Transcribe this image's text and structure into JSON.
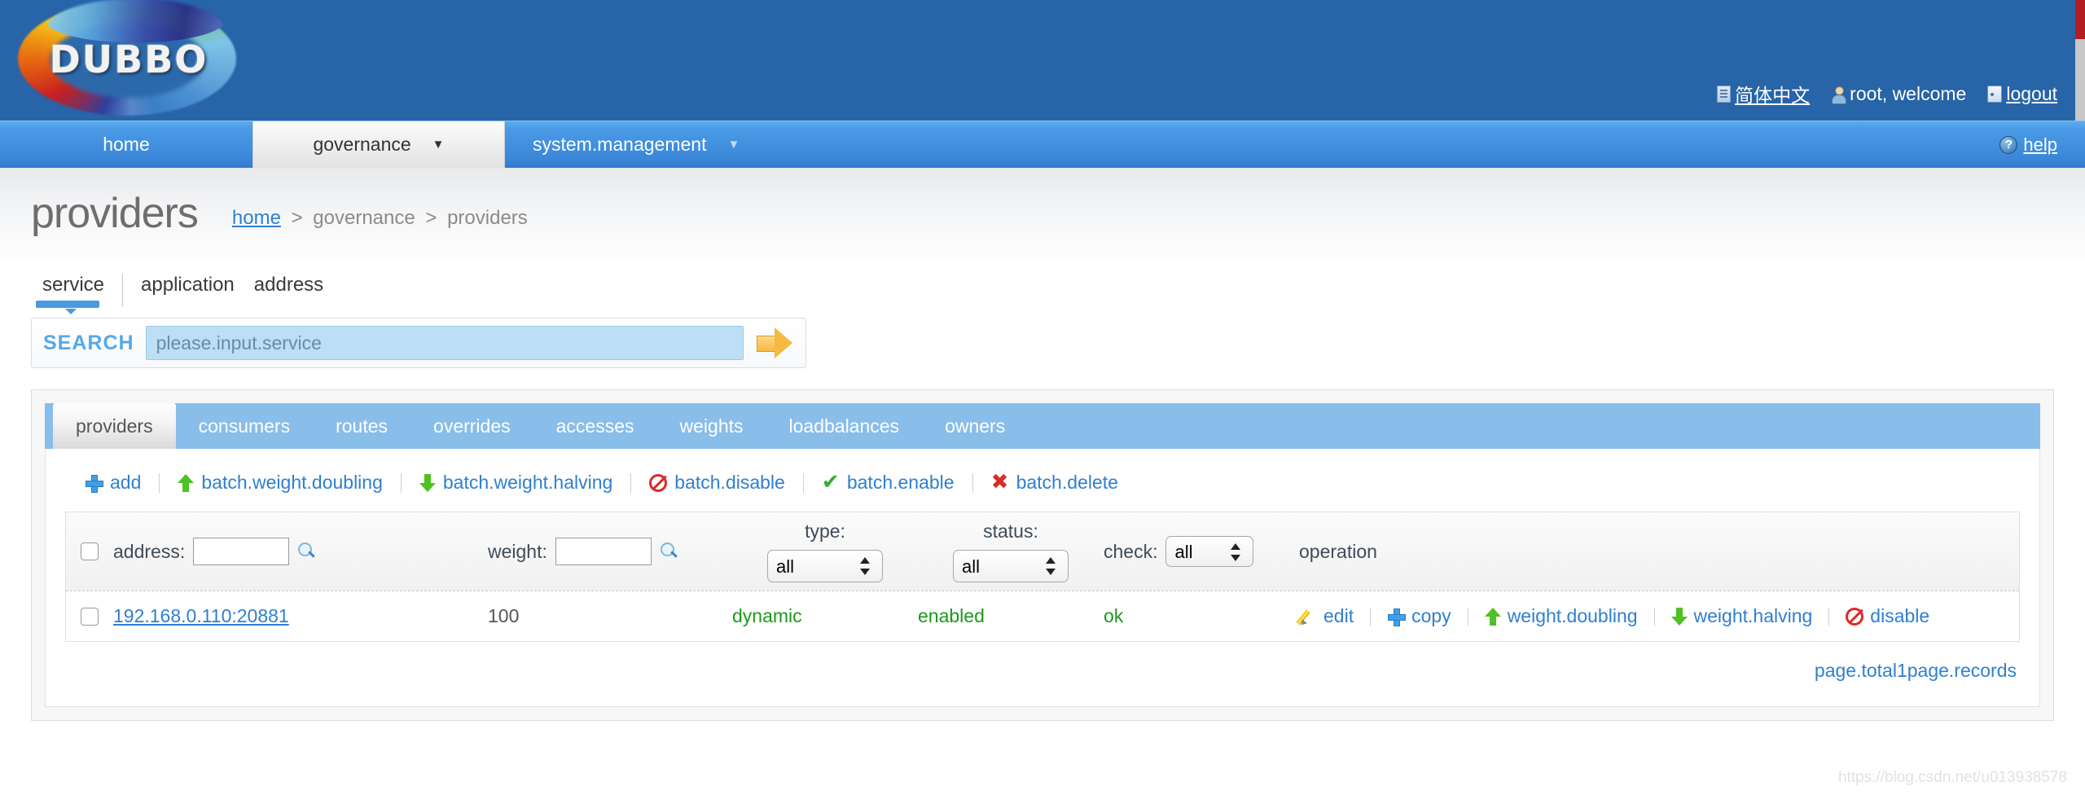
{
  "header": {
    "logo_text": "DUBBO",
    "lang_link": "简体中文",
    "lang_icon": "document-icon",
    "user_text": "root, welcome",
    "user_icon": "user-icon",
    "logout_link": "logout",
    "logout_icon": "logout-door-icon",
    "accent_blue": "#2764a8",
    "accent_red": "#b11f23"
  },
  "nav": {
    "items": [
      {
        "label": "home",
        "caret": "",
        "active": false
      },
      {
        "label": "governance",
        "caret": "▼",
        "active": true
      },
      {
        "label": "system.management",
        "caret": "▼",
        "active": false
      }
    ],
    "help_label": "help",
    "help_icon": "help-circle-icon",
    "help_glyph": "?"
  },
  "page": {
    "title": "providers",
    "breadcrumb": {
      "home": "home",
      "sep1": ">",
      "governance": "governance",
      "sep2": ">",
      "current": "providers"
    }
  },
  "subtabs": [
    {
      "label": "service",
      "active": true
    },
    {
      "label": "application",
      "active": false
    },
    {
      "label": "address",
      "active": false
    }
  ],
  "search": {
    "label": "SEARCH",
    "placeholder": "please.input.service",
    "value": "",
    "go_icon": "arrow-right-icon"
  },
  "tabs": [
    {
      "label": "providers",
      "active": true
    },
    {
      "label": "consumers",
      "active": false
    },
    {
      "label": "routes",
      "active": false
    },
    {
      "label": "overrides",
      "active": false
    },
    {
      "label": "accesses",
      "active": false
    },
    {
      "label": "weights",
      "active": false
    },
    {
      "label": "loadbalances",
      "active": false
    },
    {
      "label": "owners",
      "active": false
    }
  ],
  "toolbar": [
    {
      "label": "add",
      "icon": "plus-icon"
    },
    {
      "label": "batch.weight.doubling",
      "icon": "arrow-up-icon"
    },
    {
      "label": "batch.weight.halving",
      "icon": "arrow-down-icon"
    },
    {
      "label": "batch.disable",
      "icon": "ban-icon"
    },
    {
      "label": "batch.enable",
      "icon": "check-icon"
    },
    {
      "label": "batch.delete",
      "icon": "cross-icon"
    }
  ],
  "filters": {
    "address_label": "address:",
    "address_value": "",
    "address_search_icon": "magnifier-icon",
    "weight_label": "weight:",
    "weight_value": "",
    "weight_search_icon": "magnifier-icon",
    "type_label": "type:",
    "type_value": "all",
    "type_options": [
      "all"
    ],
    "status_label": "status:",
    "status_value": "all",
    "status_options": [
      "all"
    ],
    "check_label": "check:",
    "check_value": "all",
    "check_options": [
      "all"
    ],
    "operation_label": "operation"
  },
  "rows": [
    {
      "address": "192.168.0.110:20881",
      "weight": "100",
      "type": "dynamic",
      "status": "enabled",
      "check": "ok",
      "operations": [
        {
          "label": "edit",
          "icon": "pencil-icon"
        },
        {
          "label": "copy",
          "icon": "plus-icon"
        },
        {
          "label": "weight.doubling",
          "icon": "arrow-up-icon"
        },
        {
          "label": "weight.halving",
          "icon": "arrow-down-icon"
        },
        {
          "label": "disable",
          "icon": "ban-icon"
        }
      ]
    }
  ],
  "footer": {
    "total_text": "page.total1page.records"
  },
  "watermark": "https://blog.csdn.net/u013938578"
}
